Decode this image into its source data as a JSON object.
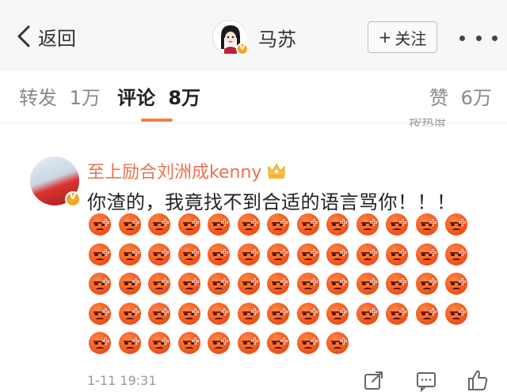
{
  "nav": {
    "back_label": "返回",
    "title": "马苏",
    "follow_label": "关注",
    "follow_plus": "+"
  },
  "tabs": [
    {
      "label": "转发",
      "count": "1万"
    },
    {
      "label": "评论",
      "count": "8万"
    },
    {
      "label": "赞",
      "count": "6万"
    }
  ],
  "peek_text": "按热度",
  "comment": {
    "author": "至上励合刘洲成kenny",
    "text": "你渣的，我竟找不到合适的语言骂你！！！",
    "emoji_name": "angry-face",
    "emoji_count": 61,
    "emoji_rows": [
      13,
      13,
      13,
      13,
      9
    ],
    "time": "1-11 19:31"
  },
  "colors": {
    "accent": "#fa7d3c",
    "author_name": "#eb7350",
    "verified_badge": "#f5a623"
  }
}
